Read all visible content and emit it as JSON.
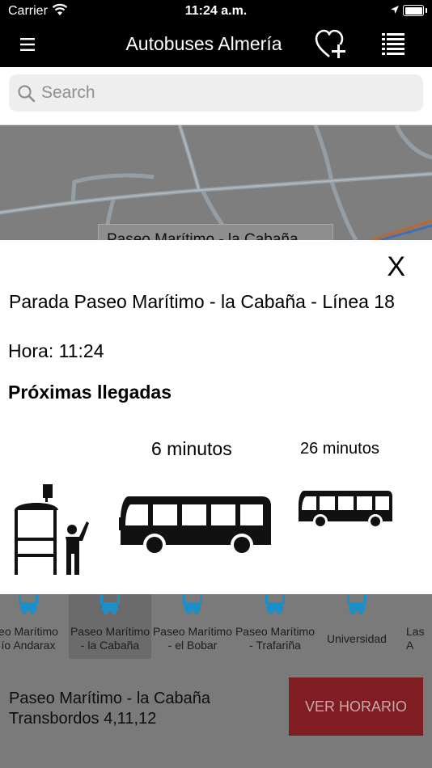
{
  "status_bar": {
    "carrier": "Carrier",
    "time": "11:24 a.m."
  },
  "nav": {
    "title": "Autobuses Almería",
    "icons": {
      "menu": "hamburger-icon",
      "favorite": "heart-plus-icon",
      "list": "list-icon"
    }
  },
  "search": {
    "placeholder": "Search",
    "value": ""
  },
  "map": {
    "callout": "Paseo Marítimo - la Cabaña"
  },
  "modal": {
    "close_label": "X",
    "stop_title": "Parada Paseo Marítimo - la Cabaña - Línea 18",
    "hour_label": "Hora: 11:24",
    "arrivals_heading": "Próximas llegadas",
    "arrivals": [
      "6 minutos",
      "26 minutos"
    ]
  },
  "stops": [
    {
      "label": "eo Marítimo\nío Andarax"
    },
    {
      "label": "Paseo Marítimo\n- la Cabaña"
    },
    {
      "label": "Paseo Marítimo\n- el Bobar"
    },
    {
      "label": "Paseo Marítimo\n- Trafariña"
    },
    {
      "label": "Universidad"
    },
    {
      "label": "Las\nA"
    }
  ],
  "selected_stop": 1,
  "footer": {
    "stop_name": "Paseo Marítimo - la Cabaña",
    "transfers": "Transbordos 4,11,12",
    "schedule_button": "VER HORARIO"
  },
  "colors": {
    "bar": "#000000",
    "accent": "#7f1d22",
    "bus_stop_blue": "#1a8fc8",
    "overlay": "#7a7a7a"
  }
}
